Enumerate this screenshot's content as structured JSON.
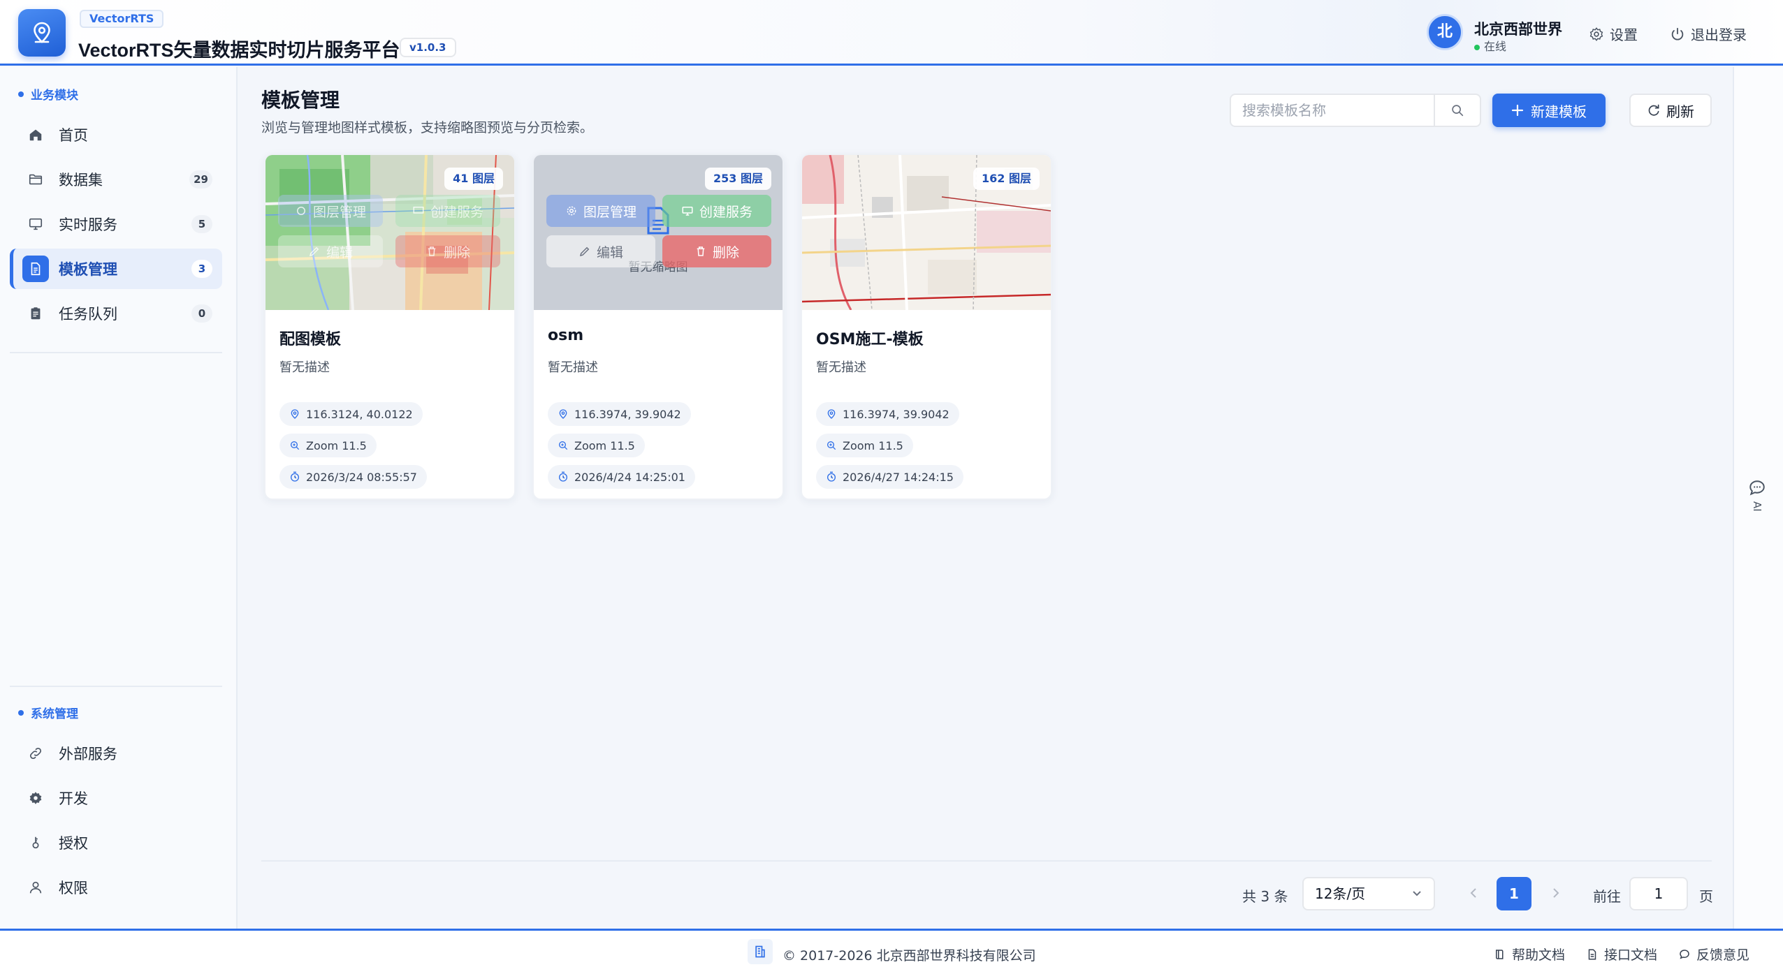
{
  "app": {
    "brand_tag": "VectorRTS",
    "title": "VectorRTS矢量数据实时切片服务平台",
    "version": "v1.0.3"
  },
  "user": {
    "avatar_text": "北",
    "name": "北京西部世界",
    "status": "在线",
    "settings_label": "设置",
    "logout_label": "退出登录"
  },
  "sidebar": {
    "business_title": "业务模块",
    "business_items": [
      {
        "label": "首页",
        "icon": "home-icon",
        "badge": ""
      },
      {
        "label": "数据集",
        "icon": "folder-icon",
        "badge": "29"
      },
      {
        "label": "实时服务",
        "icon": "monitor-icon",
        "badge": "5"
      },
      {
        "label": "模板管理",
        "icon": "document-icon",
        "badge": "3",
        "active": true
      },
      {
        "label": "任务队列",
        "icon": "clipboard-icon",
        "badge": "0"
      }
    ],
    "system_title": "系统管理",
    "system_items": [
      {
        "label": "外部服务",
        "icon": "link-icon"
      },
      {
        "label": "开发",
        "icon": "gear-icon"
      },
      {
        "label": "授权",
        "icon": "key-icon"
      },
      {
        "label": "权限",
        "icon": "user-icon"
      }
    ]
  },
  "page": {
    "title": "模板管理",
    "subtitle": "浏览与管理地图样式模板，支持缩略图预览与分页检索。",
    "search_placeholder": "搜索模板名称",
    "new_button": "新建模板",
    "refresh_button": "刷新"
  },
  "overlay_actions": {
    "layers": "图层管理",
    "create_service": "创建服务",
    "edit": "编辑",
    "delete": "删除",
    "no_thumb": "暂无缩略图"
  },
  "templates": [
    {
      "name": "配图模板",
      "desc": "暂无描述",
      "layers": "41 图层",
      "center": "116.3124, 40.0122",
      "zoom": "Zoom 11.5",
      "time": "2026/3/24 08:55:57"
    },
    {
      "name": "osm",
      "desc": "暂无描述",
      "layers": "253 图层",
      "center": "116.3974, 39.9042",
      "zoom": "Zoom 11.5",
      "time": "2026/4/24 14:25:01"
    },
    {
      "name": "OSM施工-模板",
      "desc": "暂无描述",
      "layers": "162 图层",
      "center": "116.3974, 39.9042",
      "zoom": "Zoom 11.5",
      "time": "2026/4/27 14:24:15"
    }
  ],
  "pagination": {
    "total": "共 3 条",
    "page_size": "12条/页",
    "current": "1",
    "goto_label": "前往",
    "goto_value": "1",
    "page_unit": "页"
  },
  "rail": {
    "ai_label": "AI"
  },
  "footer": {
    "copyright": "© 2017-2026 北京西部世界科技有限公司",
    "help": "帮助文档",
    "api": "接口文档",
    "feedback": "反馈意见"
  },
  "colors": {
    "primary": "#2f6fe8",
    "danger": "#e8696a",
    "success": "#6fcf8f"
  }
}
